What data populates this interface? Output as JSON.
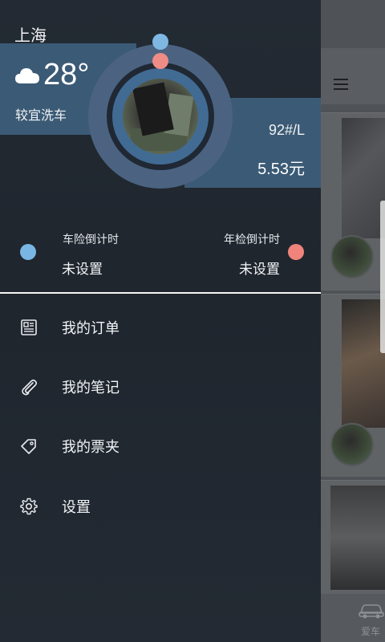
{
  "location": {
    "city": "上海"
  },
  "weather": {
    "temperature": "28°",
    "advice": "较宜洗车",
    "icon": "cloud-icon"
  },
  "fuel": {
    "type": "92#/L",
    "price": "5.53元"
  },
  "countdowns": {
    "insurance": {
      "title": "车险倒计时",
      "value": "未设置",
      "color": "#7ab6e3"
    },
    "inspection": {
      "title": "年检倒计时",
      "value": "未设置",
      "color": "#f0847c"
    }
  },
  "menu": {
    "items": [
      {
        "label": "我的订单",
        "icon": "newspaper-icon"
      },
      {
        "label": "我的笔记",
        "icon": "paperclip-icon"
      },
      {
        "label": "我的票夹",
        "icon": "tag-icon"
      },
      {
        "label": "设置",
        "icon": "gear-icon"
      }
    ]
  },
  "background_app": {
    "bottom_nav_label": "爱车"
  },
  "colors": {
    "band": "#3b5a75",
    "ring": "#4b6381",
    "drawer_bg": "#232a33"
  }
}
